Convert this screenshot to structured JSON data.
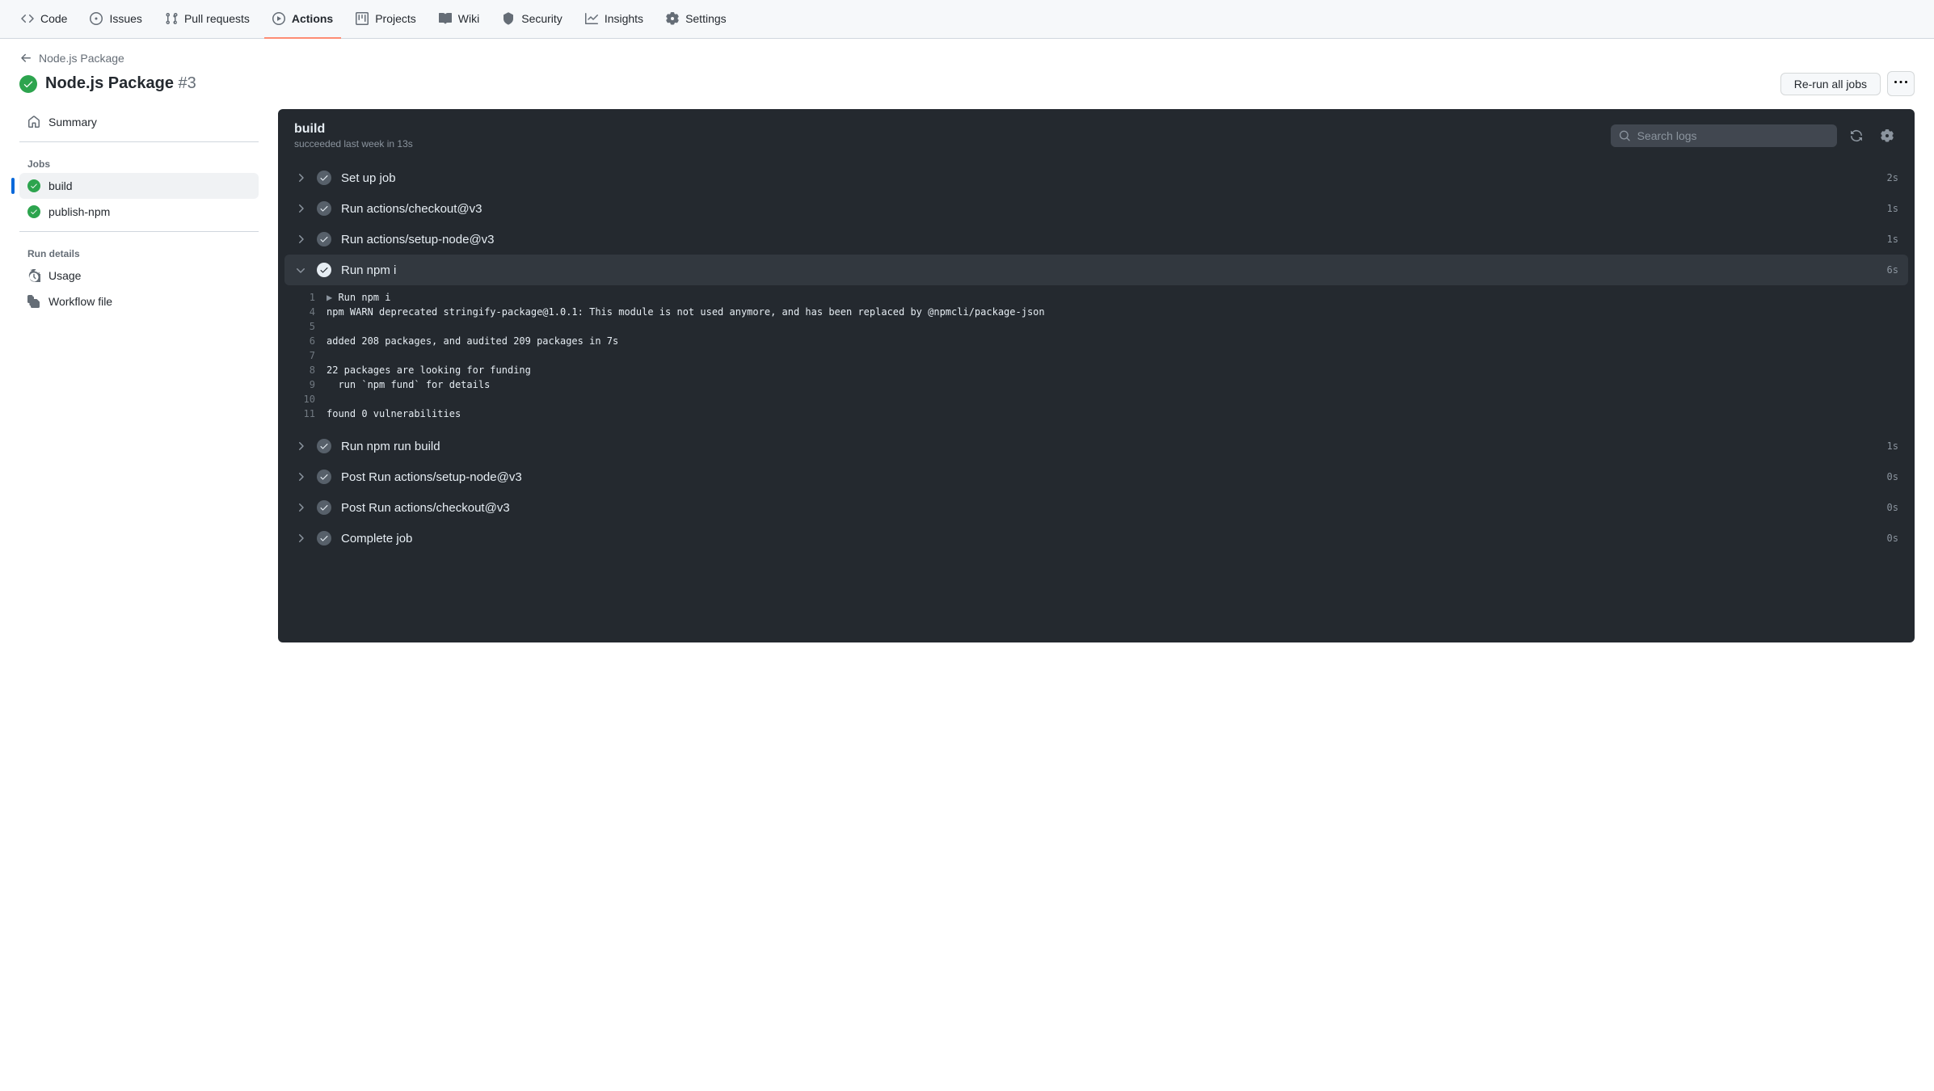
{
  "nav": {
    "items": [
      {
        "label": "Code",
        "icon": "code"
      },
      {
        "label": "Issues",
        "icon": "issue"
      },
      {
        "label": "Pull requests",
        "icon": "pr"
      },
      {
        "label": "Actions",
        "icon": "play",
        "active": true
      },
      {
        "label": "Projects",
        "icon": "project"
      },
      {
        "label": "Wiki",
        "icon": "book"
      },
      {
        "label": "Security",
        "icon": "shield"
      },
      {
        "label": "Insights",
        "icon": "graph"
      },
      {
        "label": "Settings",
        "icon": "gear"
      }
    ]
  },
  "breadcrumb": {
    "parent": "Node.js Package"
  },
  "header": {
    "title": "Node.js Package",
    "run_number": "#3",
    "rerun_label": "Re-run all jobs"
  },
  "sidebar": {
    "summary_label": "Summary",
    "jobs_heading": "Jobs",
    "jobs": [
      {
        "label": "build",
        "active": true
      },
      {
        "label": "publish-npm",
        "active": false
      }
    ],
    "run_details_heading": "Run details",
    "usage_label": "Usage",
    "workflow_file_label": "Workflow file"
  },
  "log": {
    "job_title": "build",
    "job_subtitle": "succeeded last week in 13s",
    "search_placeholder": "Search logs",
    "steps": [
      {
        "name": "Set up job",
        "time": "2s",
        "expanded": false
      },
      {
        "name": "Run actions/checkout@v3",
        "time": "1s",
        "expanded": false
      },
      {
        "name": "Run actions/setup-node@v3",
        "time": "1s",
        "expanded": false
      },
      {
        "name": "Run npm i",
        "time": "6s",
        "expanded": true
      },
      {
        "name": "Run npm run build",
        "time": "1s",
        "expanded": false
      },
      {
        "name": "Post Run actions/setup-node@v3",
        "time": "0s",
        "expanded": false
      },
      {
        "name": "Post Run actions/checkout@v3",
        "time": "0s",
        "expanded": false
      },
      {
        "name": "Complete job",
        "time": "0s",
        "expanded": false
      }
    ],
    "expanded_lines": [
      {
        "n": "1",
        "summary": true,
        "text": "Run npm i"
      },
      {
        "n": "4",
        "text": "npm WARN deprecated stringify-package@1.0.1: This module is not used anymore, and has been replaced by @npmcli/package-json"
      },
      {
        "n": "5",
        "text": ""
      },
      {
        "n": "6",
        "text": "added 208 packages, and audited 209 packages in 7s"
      },
      {
        "n": "7",
        "text": ""
      },
      {
        "n": "8",
        "text": "22 packages are looking for funding"
      },
      {
        "n": "9",
        "text": "  run `npm fund` for details"
      },
      {
        "n": "10",
        "text": ""
      },
      {
        "n": "11",
        "text": "found 0 vulnerabilities"
      }
    ]
  }
}
